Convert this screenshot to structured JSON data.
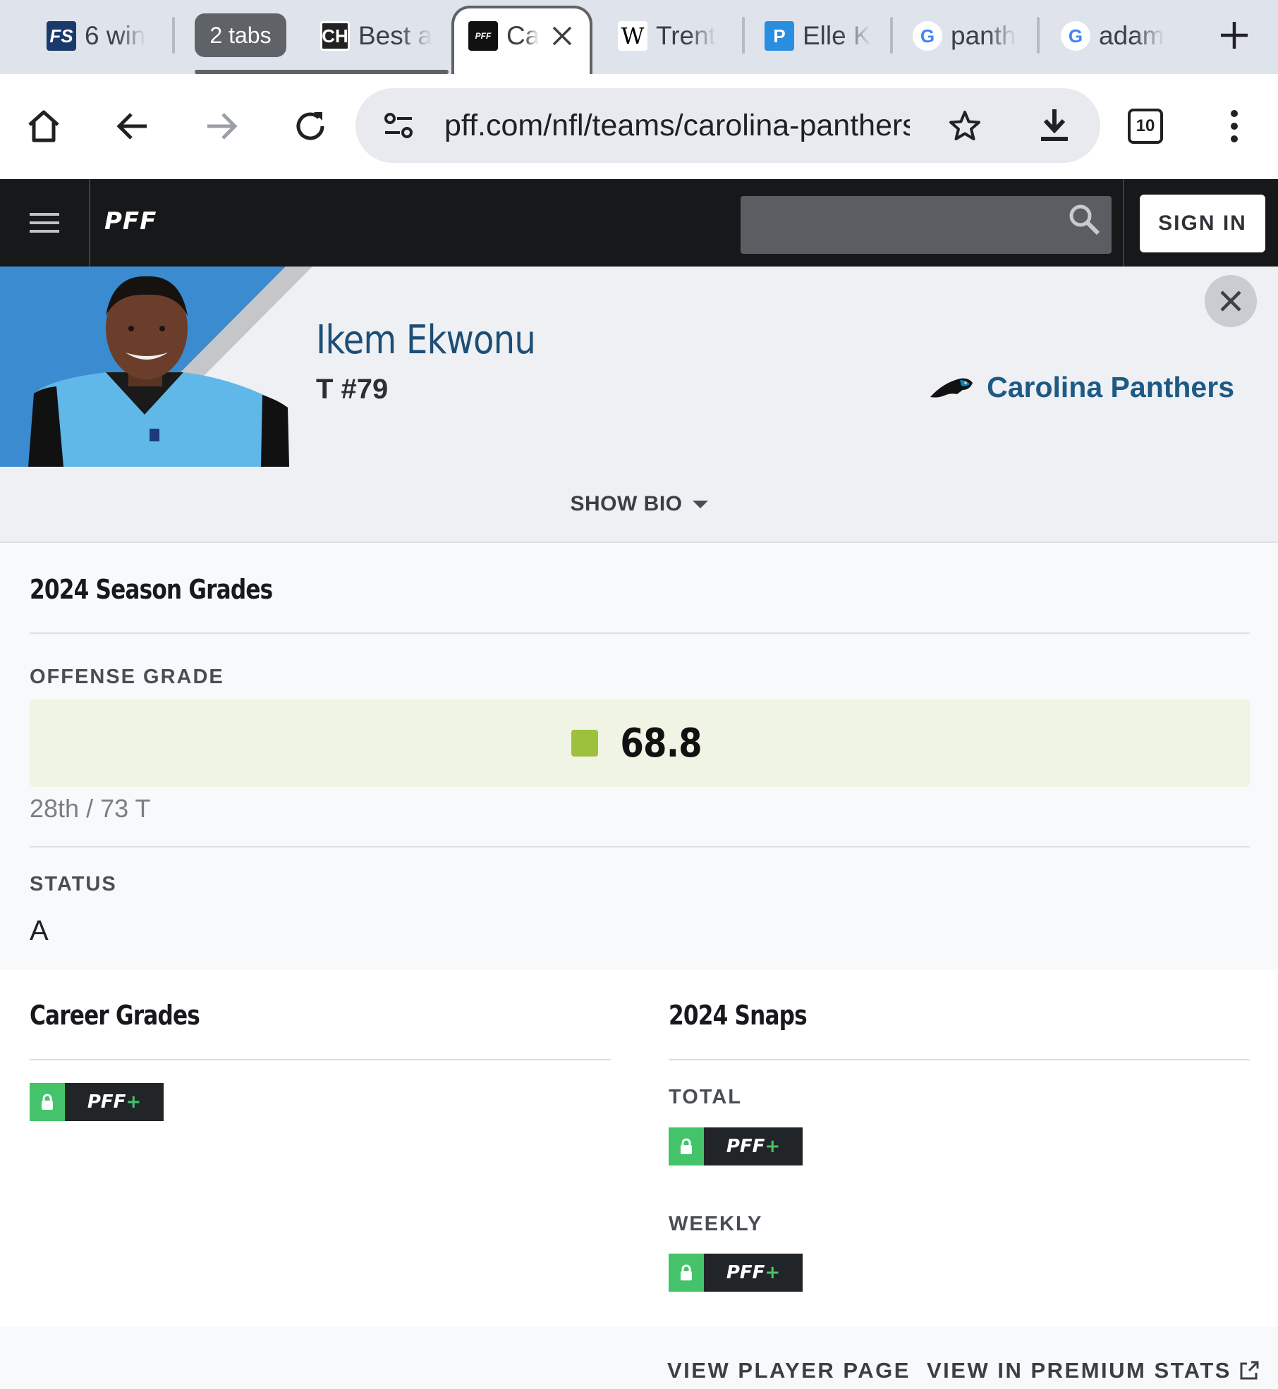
{
  "browser": {
    "tabs": [
      {
        "label": "6 win",
        "favicon": "fs"
      },
      {
        "label": "Best a",
        "favicon": "ch"
      },
      {
        "label": "Ca",
        "favicon": "pff",
        "active": true
      },
      {
        "label": "Trent",
        "favicon": "wikipedia"
      },
      {
        "label": "Elle K",
        "favicon": "p"
      },
      {
        "label": "panth",
        "favicon": "google"
      },
      {
        "label": "adam",
        "favicon": "google"
      }
    ],
    "tab_group_label": "2 tabs",
    "favicon_text": {
      "fs": "FS",
      "ch": "CH",
      "pff": "PFF",
      "wikipedia": "W",
      "p": "P",
      "google": "G"
    },
    "url": "pff.com/nfl/teams/carolina-panthers",
    "tab_count": "10"
  },
  "site": {
    "logo": "PFF",
    "signin_label": "SIGN IN",
    "search_placeholder": ""
  },
  "player": {
    "name": "Ikem Ekwonu",
    "position_number": "T #79",
    "team": "Carolina Panthers",
    "show_bio_label": "SHOW BIO"
  },
  "season_grades": {
    "title": "2024 Season Grades",
    "offense_label": "OFFENSE GRADE",
    "offense_grade": "68.8",
    "rank": "28th / 73 T",
    "status_label": "STATUS",
    "status_value": "A"
  },
  "career_grades": {
    "title": "Career Grades"
  },
  "snaps": {
    "title": "2024 Snaps",
    "total_label": "TOTAL",
    "weekly_label": "WEEKLY"
  },
  "pffplus_mark": "PFF",
  "footer": {
    "view_player_page": "VIEW PLAYER PAGE",
    "view_premium": "VIEW IN PREMIUM STATS"
  },
  "colors": {
    "panthers_blue": "#1d5a85",
    "grade_green": "#9dc13d",
    "pffplus_green": "#44c36a",
    "header_black": "#16181a"
  }
}
